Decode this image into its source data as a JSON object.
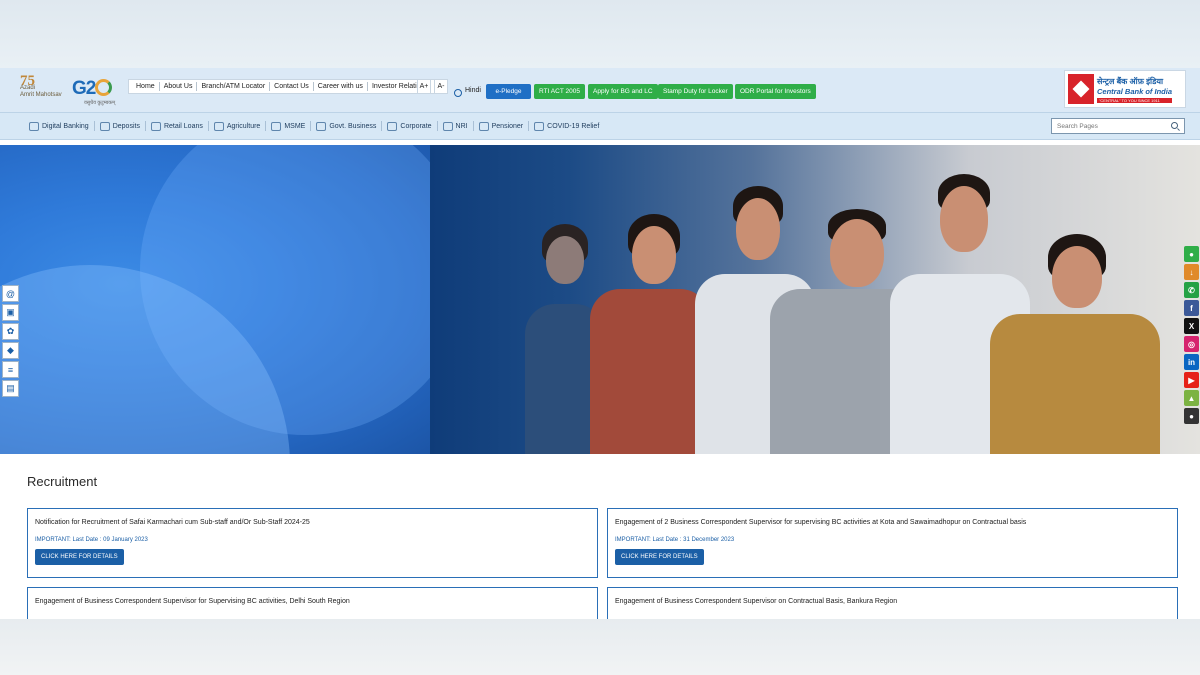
{
  "header": {
    "azadi_logo_text": [
      "75",
      "Azadi",
      "Amrit Mahotsav"
    ],
    "g20_logo_text": "G2",
    "g20_tagline": "वसुधैव कुटुम्बकम्",
    "top_links": [
      "Home",
      "About Us",
      "Branch/ATM Locator",
      "Contact Us",
      "Career with us",
      "Investor Relations"
    ],
    "font_increase": "A+",
    "font_decrease": "A-",
    "language": "Hindi",
    "buttons": [
      {
        "label": "e-Pledge",
        "color": "#1f6fc5"
      },
      {
        "label": "RTI ACT 2005",
        "color": "#2fae48"
      },
      {
        "label": "Apply for BG and LC",
        "color": "#2fae48"
      },
      {
        "label": "Stamp Duty for Locker",
        "color": "#2fae48"
      },
      {
        "label": "ODR Portal for Investors",
        "color": "#2fae48"
      }
    ],
    "bank_name_hindi": "सेन्ट्रल बैंक ऑफ़ इंडिया",
    "bank_name_english": "Central Bank of India",
    "bank_tagline": "\"CENTRAL\" TO YOU SINCE 1911"
  },
  "nav": {
    "items": [
      "Digital Banking",
      "Deposits",
      "Retail Loans",
      "Agriculture",
      "MSME",
      "Govt. Business",
      "Corporate",
      "NRI",
      "Pensioner",
      "COVID-19 Relief"
    ],
    "search_placeholder": "Search Pages"
  },
  "side_left_icons": [
    "@",
    "▣",
    "✿",
    "◆",
    "≡",
    "▤"
  ],
  "side_right_icons": [
    {
      "name": "person-icon",
      "glyph": "●",
      "color": "#2fae48"
    },
    {
      "name": "download-icon",
      "glyph": "↓",
      "color": "#e08a2a"
    },
    {
      "name": "whatsapp-icon",
      "glyph": "✆",
      "color": "#25a244"
    },
    {
      "name": "facebook-icon",
      "glyph": "f",
      "color": "#3b5998"
    },
    {
      "name": "x-icon",
      "glyph": "X",
      "color": "#111111"
    },
    {
      "name": "instagram-icon",
      "glyph": "◎",
      "color": "#d6246e"
    },
    {
      "name": "linkedin-icon",
      "glyph": "in",
      "color": "#0a66c2"
    },
    {
      "name": "youtube-icon",
      "glyph": "▶",
      "color": "#e62117"
    },
    {
      "name": "android-icon",
      "glyph": "▲",
      "color": "#7cb342"
    },
    {
      "name": "apple-icon",
      "glyph": "●",
      "color": "#333333"
    }
  ],
  "recruitment": {
    "title": "Recruitment",
    "cards": [
      {
        "title": "Notification for Recruitment of Safai Karmachari cum Sub-staff and/Or Sub-Staff 2024-25",
        "important": "IMPORTANT: Last Date : 09 January 2023",
        "button": "CLICK HERE FOR DETAILS"
      },
      {
        "title": "Engagement of 2 Business Correspondent Supervisor for supervising BC activities at Kota and Sawaimadhopur on Contractual basis",
        "important": "IMPORTANT: Last Date : 31 December 2023",
        "button": "CLICK HERE FOR DETAILS"
      },
      {
        "title": "Engagement of Business Correspondent Supervisor for Supervising BC activities, Delhi South Region",
        "important": "",
        "button": ""
      },
      {
        "title": "Engagement of Business Correspondent Supervisor on Contractual Basis, Bankura Region",
        "important": "",
        "button": ""
      }
    ]
  }
}
